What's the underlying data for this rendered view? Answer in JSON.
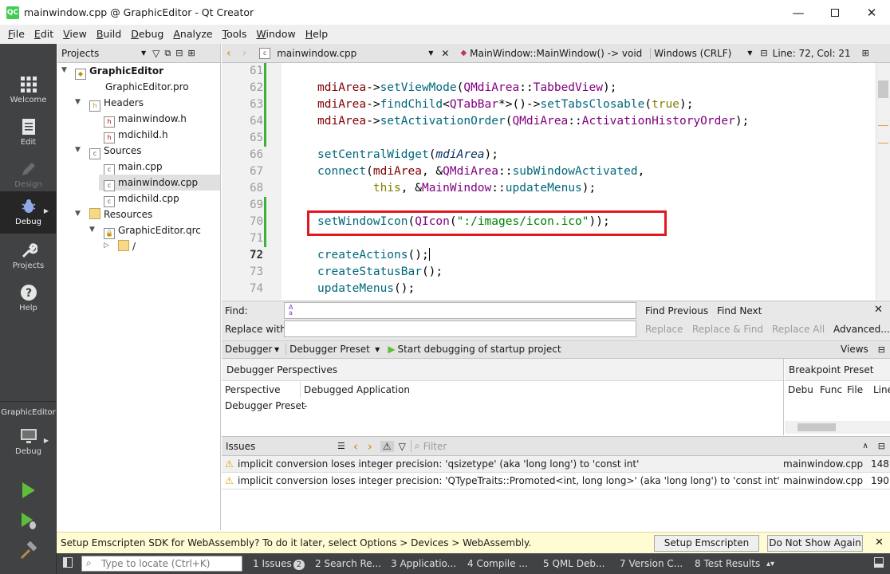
{
  "window": {
    "title": "mainwindow.cpp @ GraphicEditor - Qt Creator",
    "app_icon": "QC"
  },
  "menu": [
    {
      "label": "File",
      "u": "F",
      "rest": "ile"
    },
    {
      "label": "Edit",
      "u": "E",
      "rest": "dit"
    },
    {
      "label": "View",
      "u": "V",
      "rest": "iew"
    },
    {
      "label": "Build",
      "u": "B",
      "rest": "uild"
    },
    {
      "label": "Debug",
      "u": "D",
      "rest": "ebug"
    },
    {
      "label": "Analyze",
      "u": "A",
      "rest": "nalyze"
    },
    {
      "label": "Tools",
      "u": "T",
      "rest": "ools"
    },
    {
      "label": "Window",
      "u": "W",
      "rest": "indow"
    },
    {
      "label": "Help",
      "u": "H",
      "rest": "elp"
    }
  ],
  "modes": {
    "welcome": "Welcome",
    "edit": "Edit",
    "design": "Design",
    "debug": "Debug",
    "projects": "Projects",
    "help": "Help",
    "kit_project": "GraphicEditor",
    "kit_mode": "Debug"
  },
  "projects": {
    "header": "Projects",
    "tree": {
      "root": "GraphicEditor",
      "pro": "GraphicEditor.pro",
      "headers": "Headers",
      "h1": "mainwindow.h",
      "h2": "mdichild.h",
      "sources": "Sources",
      "s1": "main.cpp",
      "s2": "mainwindow.cpp",
      "s3": "mdichild.cpp",
      "resources": "Resources",
      "qrc": "GraphicEditor.qrc",
      "slash": "/"
    }
  },
  "editor": {
    "file": "mainwindow.cpp",
    "symbol": "MainWindow::MainWindow() -> void",
    "line_ending": "Windows (CRLF)",
    "position": "Line: 72, Col: 21",
    "line_numbers": [
      "61",
      "62",
      "63",
      "64",
      "65",
      "66",
      "67",
      "68",
      "69",
      "70",
      "71",
      "72",
      "73",
      "74"
    ],
    "highlight_color": "#e0191f"
  },
  "find": {
    "find_label": "Find:",
    "replace_label": "Replace with:",
    "find_previous": "Find Previous",
    "find_next": "Find Next",
    "replace": "Replace",
    "replace_find": "Replace & Find",
    "replace_all": "Replace All",
    "advanced": "Advanced..."
  },
  "debugger": {
    "combo1": "Debugger",
    "combo2": "Debugger Preset",
    "start": "Start debugging of startup project",
    "views": "Views",
    "perspectives_title": "Debugger Perspectives",
    "col_perspective": "Perspective",
    "col_value": "Debugged Application",
    "row2_key": "Debugger Preset",
    "row2_val": "-",
    "bp_title": "Breakpoint Preset",
    "bp_cols": [
      "Debu",
      "Func",
      "File",
      "Line"
    ]
  },
  "issues": {
    "title": "Issues",
    "filter_placeholder": "Filter",
    "rows": [
      {
        "text": "implicit conversion loses integer precision: 'qsizetype' (aka 'long long') to 'const int'",
        "file": "mainwindow.cpp",
        "line": "148"
      },
      {
        "text": "implicit conversion loses integer precision: 'QTypeTraits::Promoted<int, long long>' (aka 'long long') to 'const int'",
        "file": "mainwindow.cpp",
        "line": "190"
      }
    ]
  },
  "notification": {
    "text": "Setup Emscripten SDK for WebAssembly? To do it later, select Options > Devices > WebAssembly.",
    "setup_button": "Setup Emscripten SDK",
    "dismiss_button": "Do Not Show Again"
  },
  "statusbar": {
    "locate_placeholder": "Type to locate (Ctrl+K)",
    "tabs": [
      "1  Issues",
      "2  Search Re...",
      "3  Applicatio...",
      "4  Compile ...",
      "5  QML Deb...",
      "7  Version C...",
      "8  Test Results"
    ],
    "issues_count": "2"
  }
}
